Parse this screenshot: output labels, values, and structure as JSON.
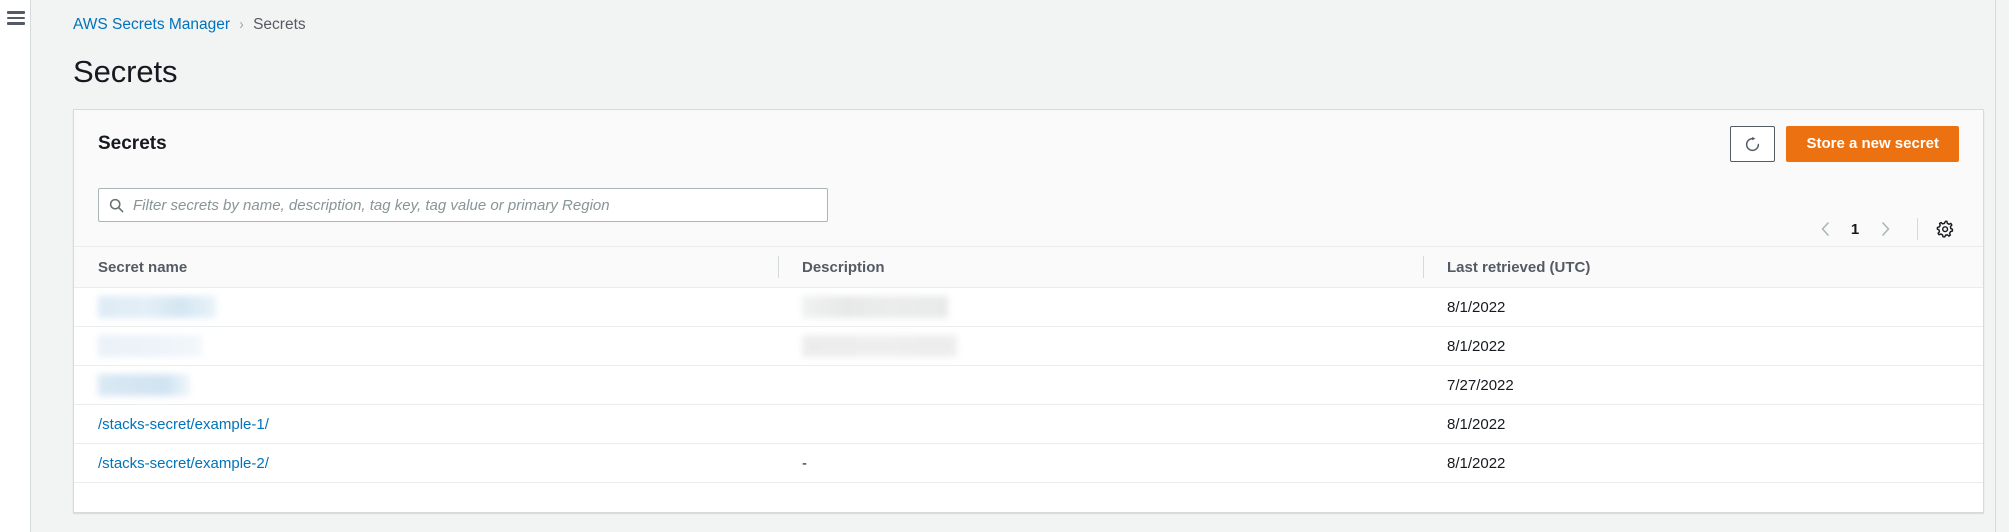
{
  "nav": {
    "menu_icon": "hamburger-menu-icon"
  },
  "breadcrumb": {
    "root": "AWS Secrets Manager",
    "separator": "›",
    "current": "Secrets"
  },
  "page": {
    "title": "Secrets"
  },
  "card": {
    "title": "Secrets",
    "refresh_icon": "refresh-icon",
    "primary_button": "Store a new secret"
  },
  "search": {
    "icon": "search-icon",
    "placeholder": "Filter secrets by name, description, tag key, tag value or primary Region",
    "value": ""
  },
  "pagination": {
    "prev_icon": "chevron-left-icon",
    "next_icon": "chevron-right-icon",
    "current_page": "1",
    "settings_icon": "gear-icon"
  },
  "table": {
    "columns": [
      "Secret name",
      "Description",
      "Last retrieved (UTC)"
    ],
    "rows": [
      {
        "secret_name": "",
        "secret_name_redacted": true,
        "description": "",
        "description_redacted": true,
        "last_retrieved": "8/1/2022"
      },
      {
        "secret_name": "",
        "secret_name_redacted": true,
        "description": "",
        "description_redacted": true,
        "last_retrieved": "8/1/2022"
      },
      {
        "secret_name": "",
        "secret_name_redacted": true,
        "description": "",
        "description_redacted": false,
        "last_retrieved": "7/27/2022"
      },
      {
        "secret_name": "/stacks-secret/example-1/",
        "secret_name_redacted": false,
        "description": "",
        "description_redacted": false,
        "last_retrieved": "8/1/2022"
      },
      {
        "secret_name": "/stacks-secret/example-2/",
        "secret_name_redacted": false,
        "description": "-",
        "description_redacted": false,
        "last_retrieved": "8/1/2022"
      }
    ]
  },
  "colors": {
    "accent_orange": "#ec7211",
    "link_blue": "#0073bb",
    "page_background": "#f2f3f3",
    "card_background": "#ffffff",
    "header_background": "#fafafa",
    "text_primary": "#16191f",
    "text_secondary": "#545b64",
    "border": "#d5dbdb"
  }
}
